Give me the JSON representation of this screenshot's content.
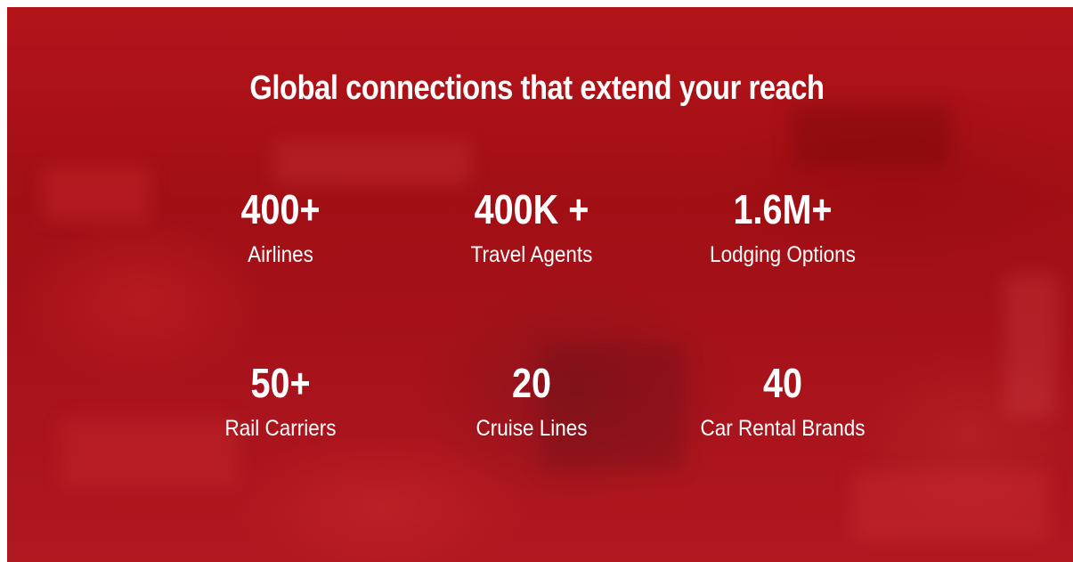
{
  "heading": "Global connections that extend your reach",
  "stats": [
    {
      "value": "400+",
      "label": "Airlines"
    },
    {
      "value": "400K +",
      "label": "Travel Agents"
    },
    {
      "value": "1.6M+",
      "label": "Lodging Options"
    },
    {
      "value": "50+",
      "label": "Rail Carriers"
    },
    {
      "value": "20",
      "label": "Cruise Lines"
    },
    {
      "value": "40",
      "label": "Car Rental Brands"
    }
  ],
  "colors": {
    "background": "#a8121a",
    "text": "#ffffff"
  }
}
